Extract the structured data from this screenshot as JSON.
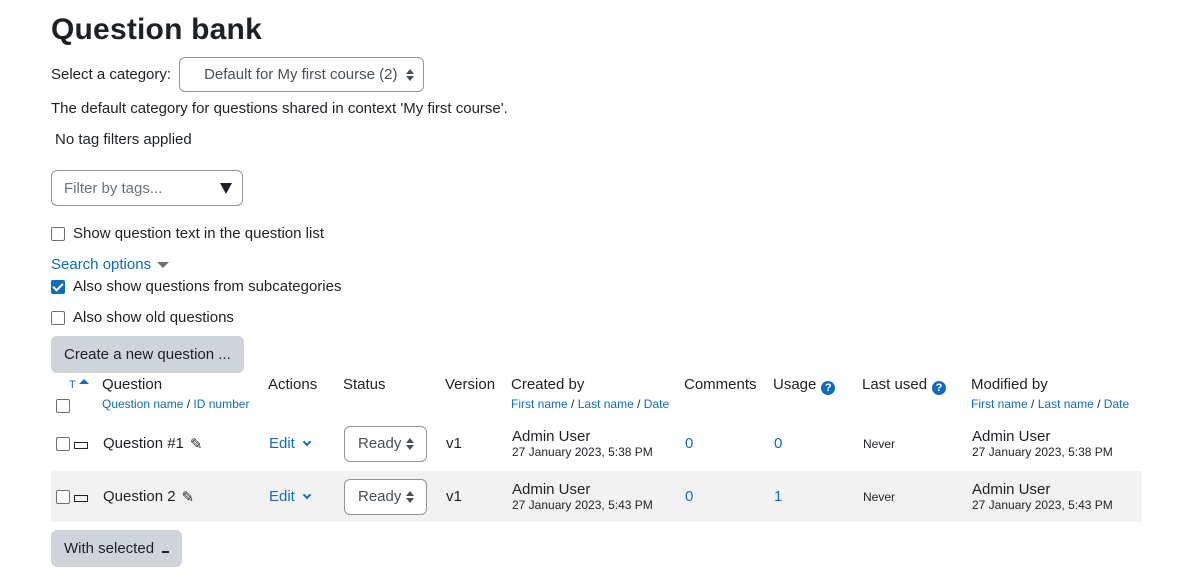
{
  "page": {
    "title": "Question bank",
    "category_label": "Select a category:",
    "category_selected": "Default for My first course (2)",
    "category_description": "The default category for questions shared in context 'My first course'.",
    "tag_filter_status": "No tag filters applied",
    "tag_filter_placeholder": "Filter by tags..."
  },
  "options": {
    "show_text_label": "Show question text in the question list",
    "show_text_checked": false,
    "search_options_label": "Search options",
    "subcategories_label": "Also show questions from subcategories",
    "subcategories_checked": true,
    "old_label": "Also show old questions",
    "old_checked": false
  },
  "buttons": {
    "create": "Create a new question ...",
    "with_selected": "With selected"
  },
  "table": {
    "sort_indicator": "T",
    "headers": {
      "question": "Question",
      "question_sub_a": "Question name",
      "question_sub_b": "ID number",
      "actions": "Actions",
      "status": "Status",
      "version": "Version",
      "created": "Created by",
      "person_sub_a": "First name",
      "person_sub_b": "Last name",
      "person_sub_c": "Date",
      "comments": "Comments",
      "usage": "Usage",
      "lastused": "Last used",
      "modified": "Modified by",
      "sep": "/"
    },
    "rows": [
      {
        "name": "Question #1",
        "action": "Edit",
        "status": "Ready",
        "version": "v1",
        "created_name": "Admin User",
        "created_date": "27 January 2023, 5:38 PM",
        "comments": "0",
        "usage": "0",
        "last_used": "Never",
        "modified_name": "Admin User",
        "modified_date": "27 January 2023, 5:38 PM"
      },
      {
        "name": "Question 2",
        "action": "Edit",
        "status": "Ready",
        "version": "v1",
        "created_name": "Admin User",
        "created_date": "27 January 2023, 5:43 PM",
        "comments": "0",
        "usage": "1",
        "last_used": "Never",
        "modified_name": "Admin User",
        "modified_date": "27 January 2023, 5:43 PM"
      }
    ]
  },
  "icons": {
    "help": "?",
    "pencil": "✎"
  },
  "colors": {
    "link": "#0f6cbf",
    "button_bg": "#ced4da",
    "row_alt": "#f2f2f2"
  }
}
